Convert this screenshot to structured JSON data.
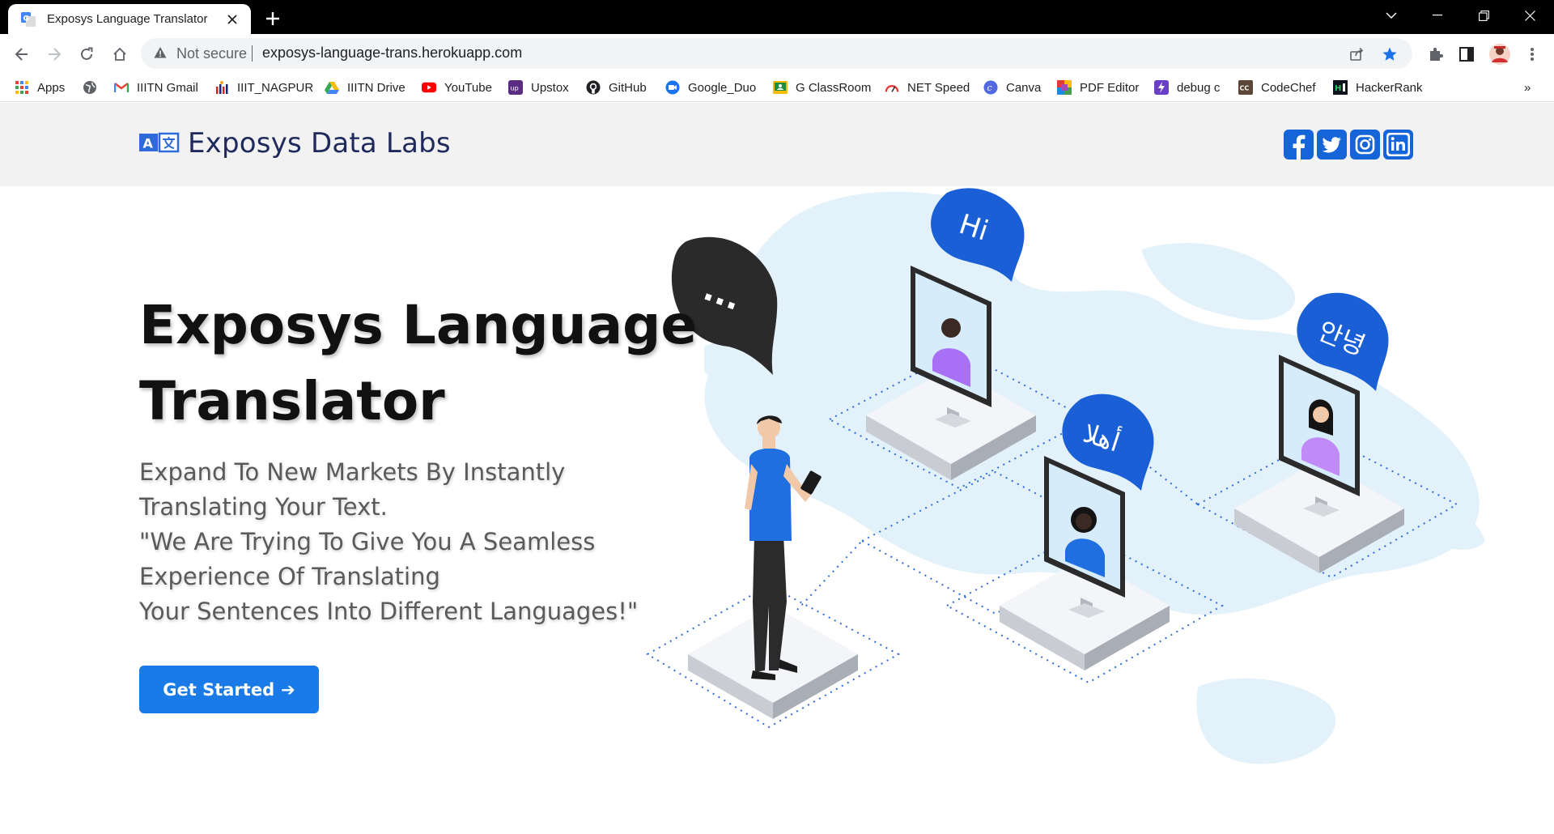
{
  "browser": {
    "tab_title": "Exposys Language Translator",
    "security_label": "Not secure",
    "url": "exposys-language-trans.herokuapp.com",
    "bookmarks": [
      {
        "label": "Apps",
        "icon": "apps-grid-icon"
      },
      {
        "label": "",
        "icon": "globe-icon"
      },
      {
        "label": "IIITN Gmail",
        "icon": "gmail-icon"
      },
      {
        "label": "IIIT_NAGPUR",
        "icon": "iiitn-logo-icon"
      },
      {
        "label": "IIITN Drive",
        "icon": "drive-icon"
      },
      {
        "label": "YouTube",
        "icon": "youtube-icon"
      },
      {
        "label": "Upstox",
        "icon": "upstox-icon"
      },
      {
        "label": "GitHub",
        "icon": "github-icon"
      },
      {
        "label": "Google_Duo",
        "icon": "duo-icon"
      },
      {
        "label": "G ClassRoom",
        "icon": "classroom-icon"
      },
      {
        "label": "NET Speed",
        "icon": "speed-gauge-icon"
      },
      {
        "label": "Canva",
        "icon": "canva-icon"
      },
      {
        "label": "PDF Editor",
        "icon": "pdf-editor-icon"
      },
      {
        "label": "debug c",
        "icon": "debug-icon"
      },
      {
        "label": "CodeChef",
        "icon": "codechef-icon"
      },
      {
        "label": "HackerRank",
        "icon": "hackerrank-icon"
      }
    ],
    "overflow_label": "»"
  },
  "site": {
    "brand": "Exposys Data Labs",
    "socials": [
      "facebook-icon",
      "twitter-icon",
      "instagram-icon",
      "linkedin-icon"
    ]
  },
  "hero": {
    "title_lines": [
      "Exposys Language",
      "Translator"
    ],
    "subtitle_lines": [
      "Expand To New Markets By Instantly",
      "Translating Your Text.",
      "\"We Are Trying To Give You A Seamless",
      "Experience Of Translating",
      "Your Sentences Into Different Languages!\""
    ],
    "cta_label": "Get Started",
    "cta_arrow": "➔",
    "bubbles": [
      "...",
      "Hi",
      "أهلا",
      "안녕"
    ]
  },
  "colors": {
    "accent": "#1a7ae8",
    "brand_text": "#1f2a5c",
    "social_blue": "#1565d8",
    "header_bg": "#f2f2f2",
    "bubble_blue": "#1a5fd6",
    "map_tint": "#e3f1fb"
  }
}
